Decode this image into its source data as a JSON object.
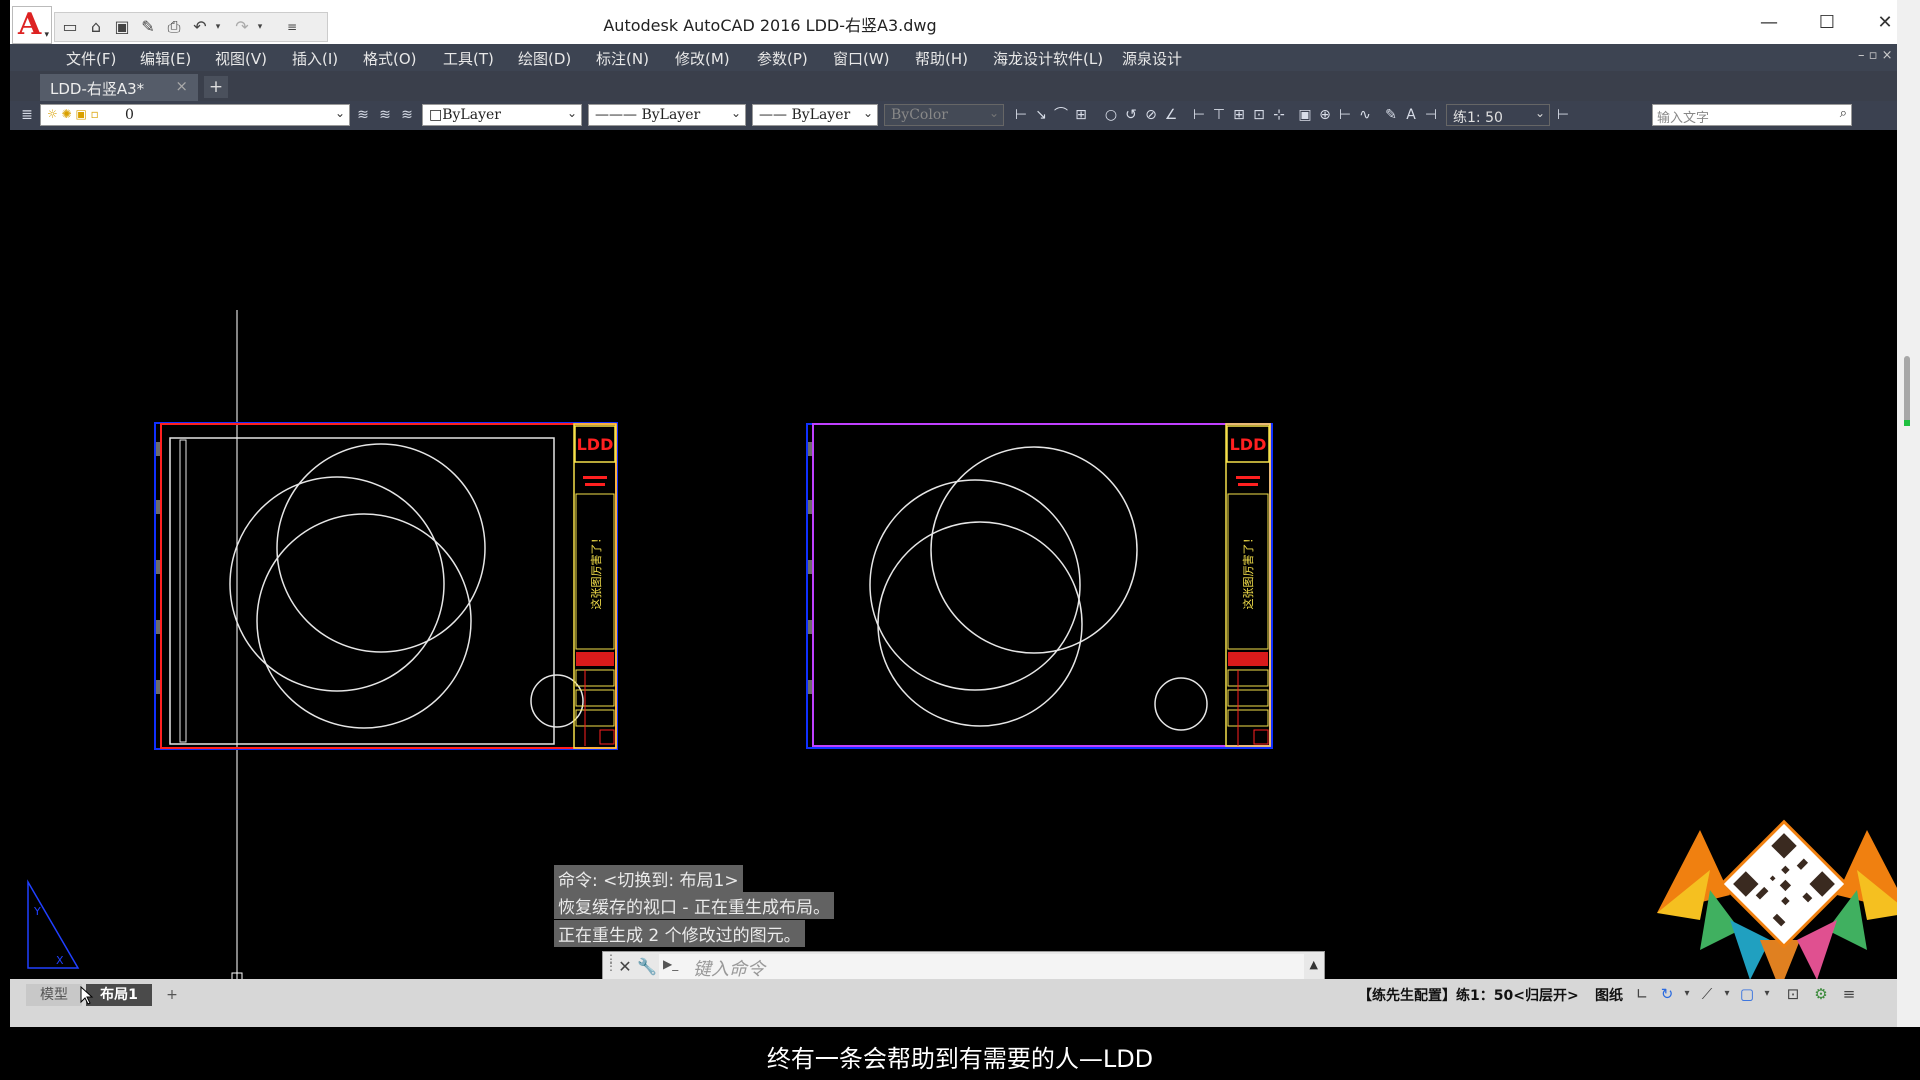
{
  "window": {
    "title": "Autodesk AutoCAD 2016      LDD-右竖A3.dwg",
    "logo_letter": "A",
    "controls": {
      "minimize": "—",
      "maximize": "☐",
      "close": "✕"
    }
  },
  "quick_access": {
    "icons": [
      "new-icon",
      "open-icon",
      "save-icon",
      "saveas-icon",
      "print-icon",
      "undo-icon",
      "redo-icon",
      "customize-icon"
    ]
  },
  "menu": {
    "items": [
      "文件(F)",
      "编辑(E)",
      "视图(V)",
      "插入(I)",
      "格式(O)",
      "工具(T)",
      "绘图(D)",
      "标注(N)",
      "修改(M)",
      "参数(P)",
      "窗口(W)",
      "帮助(H)",
      "海龙设计软件(L)",
      "源泉设计"
    ],
    "mdi_controls": "– ▫ ×"
  },
  "tabs": {
    "document": "LDD-右竖A3*",
    "close": "×",
    "add": "+"
  },
  "toolbar": {
    "layer": "0",
    "color": "□ByLayer",
    "linetype": "——— ByLayer",
    "lineweight": "—— ByLayer",
    "plotstyle": "ByColor",
    "scale": "练1: 50",
    "search_placeholder": "输入文字"
  },
  "drawing": {
    "frame_label": "这张图厉害了！",
    "logo_text": "LDD",
    "colors": {
      "background": "#000000",
      "viewport_border": "#ff2020",
      "paper_edge": "#1030ff",
      "titleblock": "#f5e04a",
      "circles": "#e6e6e6"
    }
  },
  "command": {
    "history": [
      "命令:   <切换到: 布局1>",
      "恢复缓存的视口 - 正在重生成布局。",
      "正在重生成  2  个修改过的图元。"
    ],
    "placeholder": "键入命令",
    "prompt_icon": "▶_"
  },
  "layout_tabs": {
    "model": "模型",
    "layout1": "布局1",
    "add": "+"
  },
  "status": {
    "config": "【练先生配置】练1：50<归层开>",
    "paper": "图纸"
  },
  "subtitle": "终有一条会帮助到有需要的人—LDD"
}
